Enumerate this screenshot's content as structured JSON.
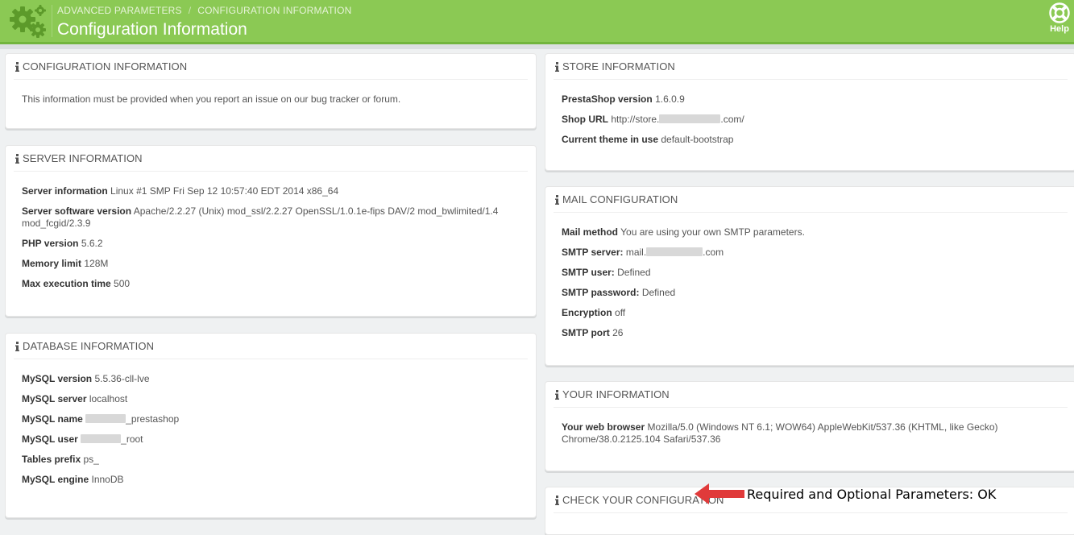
{
  "header": {
    "breadcrumb": [
      "ADVANCED PARAMETERS",
      "CONFIGURATION INFORMATION"
    ],
    "title": "Configuration Information",
    "help_label": "Help",
    "color": "#8bc954"
  },
  "panels": {
    "config": {
      "title": "CONFIGURATION INFORMATION",
      "text": "This information must be provided when you report an issue on our bug tracker or forum."
    },
    "server": {
      "title": "SERVER INFORMATION",
      "rows": [
        {
          "label": "Server information",
          "value": "Linux #1 SMP Fri Sep 12 10:57:40 EDT 2014 x86_64"
        },
        {
          "label": "Server software version",
          "value": "Apache/2.2.27 (Unix) mod_ssl/2.2.27 OpenSSL/1.0.1e-fips DAV/2 mod_bwlimited/1.4 mod_fcgid/2.3.9"
        },
        {
          "label": "PHP version",
          "value": "5.6.2"
        },
        {
          "label": "Memory limit",
          "value": "128M"
        },
        {
          "label": "Max execution time",
          "value": "500"
        }
      ]
    },
    "database": {
      "title": "DATABASE INFORMATION",
      "rows": [
        {
          "label": "MySQL version",
          "value": "5.5.36-cll-lve"
        },
        {
          "label": "MySQL server",
          "value": "localhost"
        },
        {
          "label": "MySQL name",
          "value": "_prestashop"
        },
        {
          "label": "MySQL user",
          "value": "_root"
        },
        {
          "label": "Tables prefix",
          "value": "ps_"
        },
        {
          "label": "MySQL engine",
          "value": "InnoDB"
        }
      ]
    },
    "store": {
      "title": "STORE INFORMATION",
      "rows": [
        {
          "label": "PrestaShop version",
          "value": "1.6.0.9"
        },
        {
          "label": "Shop URL",
          "value_prefix": "http://store.",
          "value_suffix": ".com/"
        },
        {
          "label": "Current theme in use",
          "value": "default-bootstrap"
        }
      ]
    },
    "mail": {
      "title": "MAIL CONFIGURATION",
      "rows": [
        {
          "label": "Mail method",
          "value": "You are using your own SMTP parameters."
        },
        {
          "label": "SMTP server:",
          "value_prefix": "mail.",
          "value_suffix": ".com"
        },
        {
          "label": "SMTP user:",
          "value": "Defined"
        },
        {
          "label": "SMTP password:",
          "value": "Defined"
        },
        {
          "label": "Encryption",
          "value": "off"
        },
        {
          "label": "SMTP port",
          "value": "26"
        }
      ]
    },
    "your_info": {
      "title": "YOUR INFORMATION",
      "rows": [
        {
          "label": "Your web browser",
          "value": "Mozilla/5.0 (Windows NT 6.1; WOW64) AppleWebKit/537.36 (KHTML, like Gecko) Chrome/38.0.2125.104 Safari/537.36"
        }
      ]
    },
    "check": {
      "title": "CHECK YOUR CONFIGURATION"
    }
  },
  "annotation": "Required and Optional Parameters: OK"
}
